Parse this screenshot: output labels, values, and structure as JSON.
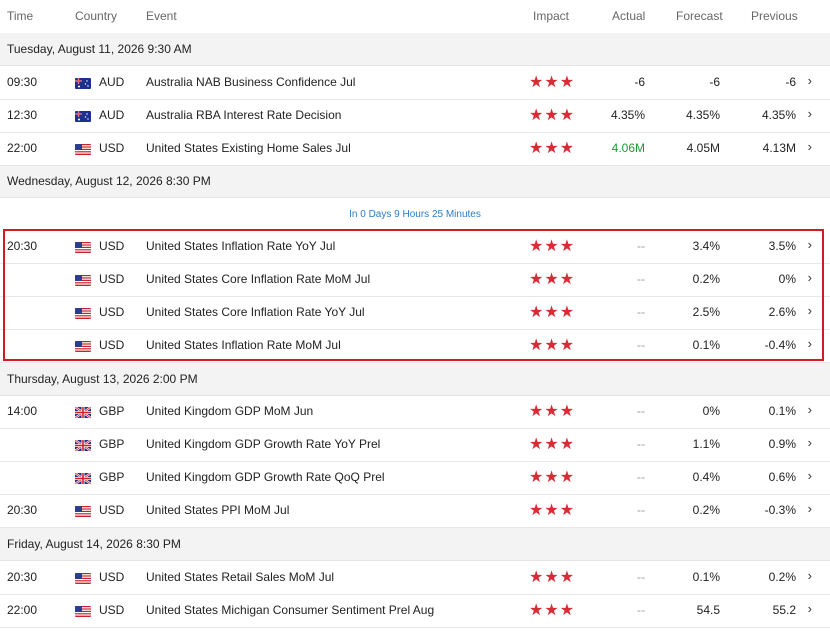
{
  "header": {
    "time": "Time",
    "country": "Country",
    "event": "Event",
    "impact": "Impact",
    "actual": "Actual",
    "forecast": "Forecast",
    "previous": "Previous"
  },
  "impact_stars": "★★★",
  "chevron": "›",
  "dates": {
    "d1": "Tuesday, August 11, 2026 9:30 AM",
    "d2": "Wednesday, August 12, 2026 8:30 PM",
    "d3": "Thursday, August 13, 2026 2:00 PM",
    "d4": "Friday, August 14, 2026 8:30 PM"
  },
  "countdown": "In 0 Days 9 Hours 25 Minutes",
  "rows": [
    {
      "time": "09:30",
      "currency": "AUD",
      "flag": "au-flag",
      "event": "Australia NAB Business Confidence Jul",
      "actual": "-6",
      "forecast": "-6",
      "previous": "-6"
    },
    {
      "time": "12:30",
      "currency": "AUD",
      "flag": "au-flag",
      "event": "Australia RBA Interest Rate Decision",
      "actual": "4.35%",
      "forecast": "4.35%",
      "previous": "4.35%"
    },
    {
      "time": "22:00",
      "currency": "USD",
      "flag": "us-flag",
      "event": "United States Existing Home Sales Jul",
      "actual": "4.06M",
      "forecast": "4.05M",
      "previous": "4.13M"
    },
    {
      "time": "20:30",
      "currency": "USD",
      "flag": "us-flag",
      "event": "United States Inflation Rate YoY Jul",
      "actual": "--",
      "forecast": "3.4%",
      "previous": "3.5%"
    },
    {
      "time": "",
      "currency": "USD",
      "flag": "us-flag",
      "event": "United States Core Inflation Rate MoM Jul",
      "actual": "--",
      "forecast": "0.2%",
      "previous": "0%"
    },
    {
      "time": "",
      "currency": "USD",
      "flag": "us-flag",
      "event": "United States Core Inflation Rate YoY Jul",
      "actual": "--",
      "forecast": "2.5%",
      "previous": "2.6%"
    },
    {
      "time": "",
      "currency": "USD",
      "flag": "us-flag",
      "event": "United States Inflation Rate MoM Jul",
      "actual": "--",
      "forecast": "0.1%",
      "previous": "-0.4%"
    },
    {
      "time": "14:00",
      "currency": "GBP",
      "flag": "uk-flag",
      "event": "United Kingdom GDP MoM Jun",
      "actual": "--",
      "forecast": "0%",
      "previous": "0.1%"
    },
    {
      "time": "",
      "currency": "GBP",
      "flag": "uk-flag",
      "event": "United Kingdom GDP Growth Rate YoY Prel",
      "actual": "--",
      "forecast": "1.1%",
      "previous": "0.9%"
    },
    {
      "time": "",
      "currency": "GBP",
      "flag": "uk-flag",
      "event": "United Kingdom GDP Growth Rate QoQ Prel",
      "actual": "--",
      "forecast": "0.4%",
      "previous": "0.6%"
    },
    {
      "time": "20:30",
      "currency": "USD",
      "flag": "us-flag",
      "event": "United States PPI MoM Jul",
      "actual": "--",
      "forecast": "0.2%",
      "previous": "-0.3%"
    },
    {
      "time": "20:30",
      "currency": "USD",
      "flag": "us-flag",
      "event": "United States Retail Sales MoM Jul",
      "actual": "--",
      "forecast": "0.1%",
      "previous": "0.2%"
    },
    {
      "time": "22:00",
      "currency": "USD",
      "flag": "us-flag",
      "event": "United States Michigan Consumer Sentiment Prel Aug",
      "actual": "--",
      "forecast": "54.5",
      "previous": "55.2"
    }
  ],
  "colors": {
    "impact_star": "#d92b35",
    "actual_positive": "#1a9c3b",
    "countdown": "#2a7cc7",
    "highlight_border": "#d21a22"
  }
}
